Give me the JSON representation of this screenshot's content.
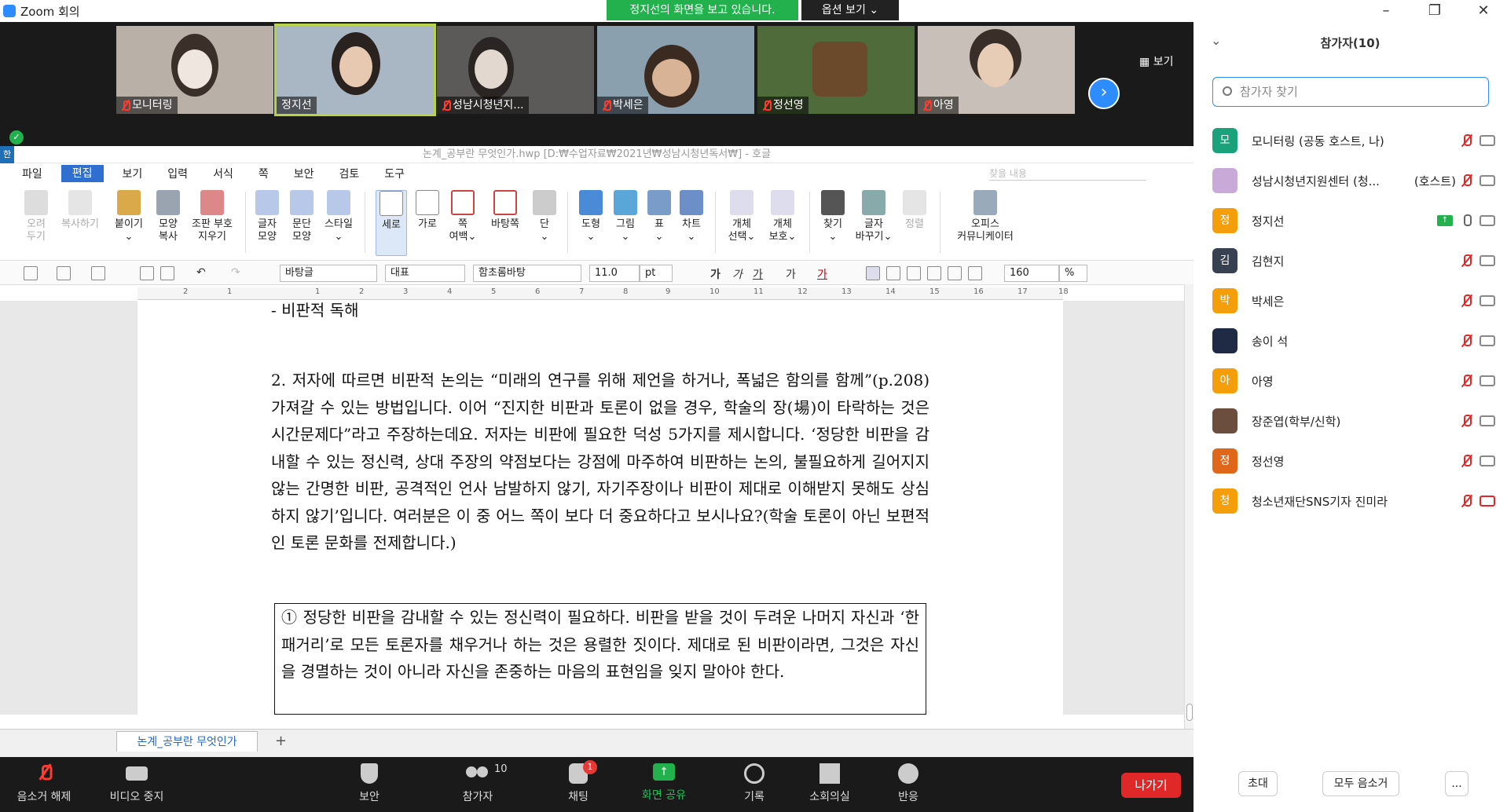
{
  "window": {
    "title": "Zoom 회의",
    "share_banner": "정지선의 화면을 보고 있습니다.",
    "view_options": "옵션 보기 ⌄",
    "gallery_label": "보기"
  },
  "video_tiles": [
    {
      "name": "모니터링",
      "muted": true
    },
    {
      "name": "정지선",
      "muted": false
    },
    {
      "name": "성남시청년지...",
      "muted": true
    },
    {
      "name": "박세은",
      "muted": true
    },
    {
      "name": "정선영",
      "muted": true
    },
    {
      "name": "아영",
      "muted": true
    }
  ],
  "hwp": {
    "title": "논계_공부란 무엇인가.hwp [D:₩수업자료₩2021년₩성남시청년독서₩] - 호글",
    "app_icon": "한",
    "menu": [
      "파일",
      "편집",
      "보기",
      "입력",
      "서식",
      "쪽",
      "보안",
      "검토",
      "도구"
    ],
    "search_placeholder": "찾을 내용",
    "ribbon": [
      {
        "label1": "오려",
        "label2": "두기",
        "icon": "scissors-icon",
        "disabled": true
      },
      {
        "label1": "복사하기",
        "label2": "",
        "icon": "copy-icon",
        "disabled": true
      },
      {
        "label1": "붙이기",
        "label2": "⌄",
        "icon": "paste-icon",
        "disabled": false
      },
      {
        "label1": "모양",
        "label2": "복사",
        "icon": "format-painter-icon",
        "disabled": false
      },
      {
        "label1": "조판 부호",
        "label2": "지우기",
        "icon": "clear-marks-icon",
        "disabled": false
      },
      {
        "label1": "글자",
        "label2": "모양",
        "icon": "char-shape-icon",
        "disabled": false
      },
      {
        "label1": "문단",
        "label2": "모양",
        "icon": "para-shape-icon",
        "disabled": false
      },
      {
        "label1": "스타일",
        "label2": "⌄",
        "icon": "style-icon",
        "disabled": false
      },
      {
        "label1": "세로",
        "label2": "",
        "icon": "portrait-icon",
        "disabled": false
      },
      {
        "label1": "가로",
        "label2": "",
        "icon": "landscape-icon",
        "disabled": false
      },
      {
        "label1": "쪽",
        "label2": "여백⌄",
        "icon": "margin-icon",
        "disabled": false
      },
      {
        "label1": "바탕쪽",
        "label2": "",
        "icon": "master-page-icon",
        "disabled": false
      },
      {
        "label1": "단",
        "label2": "⌄",
        "icon": "columns-icon",
        "disabled": false
      },
      {
        "label1": "도형",
        "label2": "⌄",
        "icon": "shape-icon",
        "disabled": false
      },
      {
        "label1": "그림",
        "label2": "⌄",
        "icon": "picture-icon",
        "disabled": false
      },
      {
        "label1": "표",
        "label2": "⌄",
        "icon": "table-icon",
        "disabled": false
      },
      {
        "label1": "차트",
        "label2": "⌄",
        "icon": "chart-icon",
        "disabled": false
      },
      {
        "label1": "개체",
        "label2": "선택⌄",
        "icon": "select-object-icon",
        "disabled": false
      },
      {
        "label1": "개체",
        "label2": "보호⌄",
        "icon": "protect-object-icon",
        "disabled": false
      },
      {
        "label1": "찾기",
        "label2": "⌄",
        "icon": "find-icon",
        "disabled": false
      },
      {
        "label1": "글자",
        "label2": "바꾸기⌄",
        "icon": "replace-icon",
        "disabled": false
      },
      {
        "label1": "정렬",
        "label2": "",
        "icon": "sort-icon",
        "disabled": true
      },
      {
        "label1": "오피스",
        "label2": "커뮤니케이터",
        "icon": "communicator-icon",
        "disabled": false
      }
    ],
    "format": {
      "style": "바탕글",
      "lang": "대표",
      "font": "함초롬바탕",
      "size": "11.0",
      "unit": "pt",
      "zoom": "160",
      "zoom_unit": "%"
    },
    "ruler_ticks": [
      "2",
      "1",
      "1",
      "2",
      "3",
      "4",
      "5",
      "6",
      "7",
      "8",
      "9",
      "10",
      "11",
      "12",
      "13",
      "14",
      "15",
      "16",
      "17",
      "18"
    ],
    "doc_prev_line": "- 비판적 독해",
    "doc_paragraph": "2. 저자에 따르면 비판적 논의는 “미래의 연구를 위해 제언을 하거나, 폭넓은 함의를 함께”(p.208) 가져갈 수 있는 방법입니다. 이어 “진지한 비판과 토론이 없을 경우, 학술의 장(場)이 타락하는 것은 시간문제다”라고 주장하는데요. 저자는 비판에 필요한 덕성 5가지를 제시합니다. ‘정당한 비판을 감내할 수 있는 정신력, 상대 주장의 약점보다는 강점에 마주하여 비판하는 논의, 불필요하게 길어지지 않는 간명한 비판, 공격적인 언사 남발하지 않기, 자기주장이나 비판이 제대로 이해받지 못해도 상심하지 않기’입니다. 여러분은 이 중 어느 쪽이 보다 더 중요하다고 보시나요?(학술 토론이 아닌 보편적인 토론 문화를 전제합니다.)",
    "doc_boxed": "① 정당한 비판을 감내할 수 있는 정신력이 필요하다. 비판을 받을 것이 두려운 나머지 자신과 ‘한 패거리’로 모든 토론자를 채우거나 하는 것은 용렬한 짓이다. 제대로 된 비판이라면, 그것은 자신을 경멸하는 것이 아니라 자신을 존중하는 마음의 표현임을 잊지 말아야 한다.",
    "tab_name": "논계_공부란 무엇인가",
    "add_tab": "+"
  },
  "zoom_controls": {
    "unmute": "음소거 해제",
    "stop_video": "비디오 중지",
    "security": "보안",
    "participants": "참가자",
    "participants_count": "10",
    "chat": "채팅",
    "chat_badge": "1",
    "share_screen": "화면 공유",
    "record": "기록",
    "breakout": "소회의실",
    "reactions": "반응",
    "leave": "나가기"
  },
  "participants_panel": {
    "title": "참가자(10)",
    "search_placeholder": "참가자 찾기",
    "invite": "초대",
    "mute_all": "모두 음소거",
    "more": "...",
    "list": [
      {
        "initial": "모",
        "name": "모니터링 (공동 호스트, 나)",
        "role": "",
        "color": "#1aa37a",
        "mic": "muted",
        "sharing": false
      },
      {
        "initial": "",
        "name": "성남시청년지원센터 (청...",
        "role": "(호스트)",
        "color": "#c9a9d8",
        "mic": "muted",
        "sharing": false
      },
      {
        "initial": "정",
        "name": "정지선",
        "role": "",
        "color": "#f59e0b",
        "mic": "on",
        "sharing": true
      },
      {
        "initial": "김",
        "name": "김현지",
        "role": "",
        "color": "#374151",
        "mic": "muted",
        "sharing": false
      },
      {
        "initial": "박",
        "name": "박세은",
        "role": "",
        "color": "#f59e0b",
        "mic": "muted",
        "sharing": false
      },
      {
        "initial": "",
        "name": "송이 석",
        "role": "",
        "color": "#1f2a44",
        "mic": "muted",
        "sharing": false
      },
      {
        "initial": "아",
        "name": "아영",
        "role": "",
        "color": "#f59e0b",
        "mic": "muted",
        "sharing": false
      },
      {
        "initial": "",
        "name": "장준엽(학부/신학)",
        "role": "",
        "color": "#6b4e3d",
        "mic": "muted",
        "sharing": false
      },
      {
        "initial": "정",
        "name": "정선영",
        "role": "",
        "color": "#e0661a",
        "mic": "muted",
        "sharing": false
      },
      {
        "initial": "청",
        "name": "청소년재단SNS기자 진미라",
        "role": "",
        "color": "#f59e0b",
        "mic": "muted",
        "sharing": false
      }
    ]
  }
}
